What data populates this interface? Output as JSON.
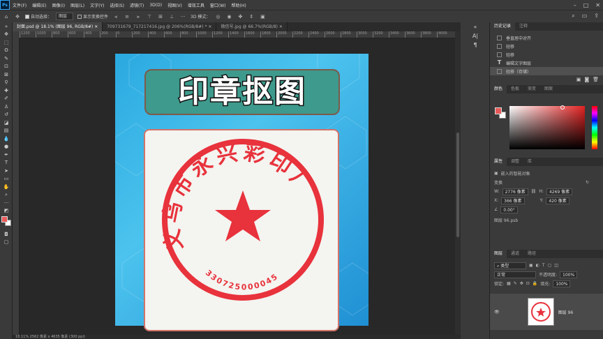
{
  "app": {
    "logo": "Ps"
  },
  "menu": [
    "文件(F)",
    "编辑(E)",
    "图像(I)",
    "图层(L)",
    "文字(Y)",
    "选择(S)",
    "滤镜(T)",
    "3D(D)",
    "视图(V)",
    "增效工具",
    "窗口(W)",
    "帮助(H)"
  ],
  "options": {
    "auto_select": "自动选择：",
    "auto_select_target": "图层",
    "show_transform": "显示变换控件",
    "mode_3d": "3D 模式："
  },
  "tabs": [
    {
      "label": "封面.psd @ 18.1% (图层 96, RGB/8#)",
      "active": true
    },
    {
      "label": "709731679_717217416.jpg @ 206%(RGB/8#) *",
      "active": false
    },
    {
      "label": "微信号.jpg @ 66.7%(RGB/8)",
      "active": false
    }
  ],
  "ruler": {
    "marks": [
      "1200",
      "1000",
      "800",
      "600",
      "400",
      "200",
      "0",
      "200",
      "400",
      "600",
      "800",
      "1000",
      "1200",
      "1400",
      "1600",
      "1800",
      "2000",
      "2200",
      "2400",
      "2600",
      "2800",
      "3000",
      "3200",
      "3400",
      "3600",
      "3800",
      "4000"
    ]
  },
  "document": {
    "title_text": "印章抠图",
    "seal": {
      "arc_text": "义乌市永兴彩印厂",
      "number": "330725000045",
      "color": "#e8323c"
    }
  },
  "status": {
    "text": "18.11%   2562 像素 x 4635 像素 (300 ppi)"
  },
  "history": {
    "tabs": [
      "历史记录",
      "注释"
    ],
    "items": [
      {
        "label": "垂直居中对齐",
        "selected": false
      },
      {
        "label": "轻移",
        "selected": false
      },
      {
        "label": "轻移",
        "selected": false
      },
      {
        "label": "编辑文字图层",
        "selected": false
      },
      {
        "label": "轻移（存储）",
        "selected": true
      }
    ]
  },
  "color_panel": {
    "tabs": [
      "颜色",
      "色板",
      "渐变",
      "图案"
    ],
    "foreground": "#e85a5a"
  },
  "properties": {
    "tabs": [
      "属性",
      "调整",
      "库"
    ],
    "object_type": "嵌入的智能对象",
    "transform_label": "变换",
    "w_label": "W:",
    "w_value": "2776 像素",
    "h_label": "H:",
    "h_value": "4269 像素",
    "x_label": "X:",
    "x_value": "366 像素",
    "y_label": "Y:",
    "y_value": "420 像素",
    "angle": "0.00°",
    "file": "图层 96.psb"
  },
  "layers": {
    "tabs": [
      "图层",
      "通道",
      "路径"
    ],
    "filter": "类型",
    "blend_mode": "正常",
    "opacity_label": "不透明度:",
    "opacity": "100%",
    "lock_label": "锁定:",
    "fill_label": "填充:",
    "fill": "100%",
    "layer_name": "图层 96"
  }
}
